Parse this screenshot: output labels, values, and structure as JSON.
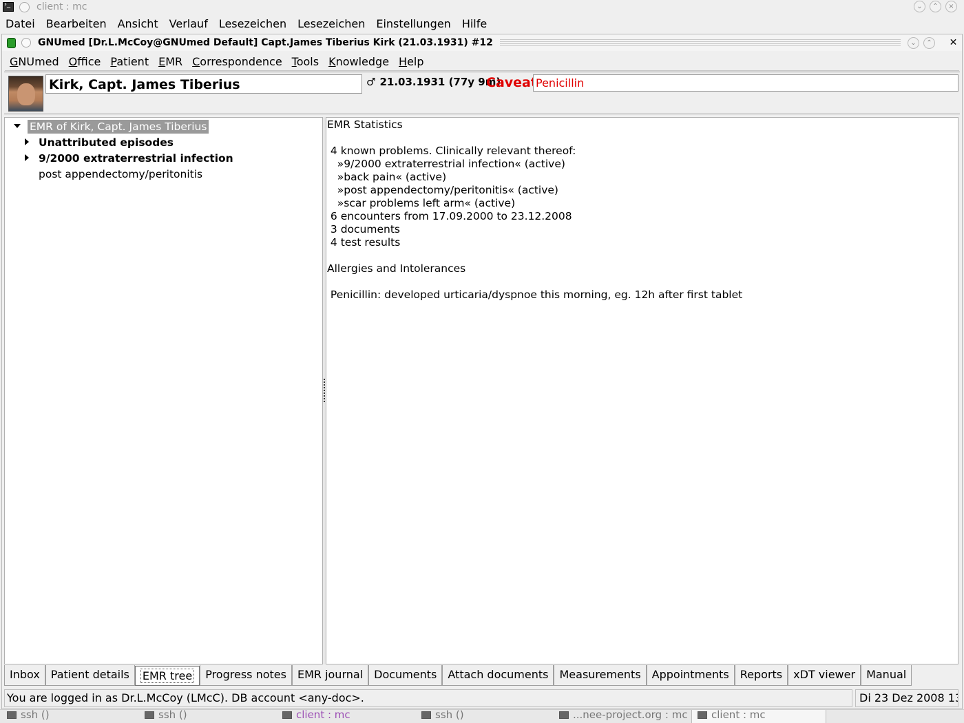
{
  "outer_window": {
    "title": "client : mc",
    "menu": [
      "Datei",
      "Bearbeiten",
      "Ansicht",
      "Verlauf",
      "Lesezeichen",
      "Lesezeichen",
      "Einstellungen",
      "Hilfe"
    ]
  },
  "gnumed_window": {
    "title": "GNUmed [Dr.L.McCoy@GNUmed Default] Capt.James Tiberius Kirk (21.03.1931) #12",
    "close_glyph": "✕",
    "menu": [
      "GNUmed",
      "Office",
      "Patient",
      "EMR",
      "Correspondence",
      "Tools",
      "Knowledge",
      "Help"
    ]
  },
  "patient": {
    "name": "Kirk, Capt. James Tiberius",
    "gender_symbol": "♂",
    "dob": "21.03.1931 (77y 9m)",
    "caveat_label": "Caveat",
    "caveat_value": "Penicillin"
  },
  "emr_tree": {
    "root": "EMR of Kirk, Capt. James Tiberius",
    "nodes": [
      {
        "label": "Unattributed episodes"
      },
      {
        "label": "9/2000 extraterrestrial infection"
      },
      {
        "label": "post appendectomy/peritonitis"
      }
    ]
  },
  "stats": {
    "lines": [
      "EMR Statistics",
      "",
      " 4 known problems. Clinically relevant thereof:",
      "   »9/2000 extraterrestrial infection« (active)",
      "   »back pain« (active)",
      "   »post appendectomy/peritonitis« (active)",
      "   »scar problems left arm« (active)",
      " 6 encounters from 17.09.2000 to 23.12.2008",
      " 3 documents",
      " 4 test results",
      "",
      "Allergies and Intolerances",
      "",
      " Penicillin: developed urticaria/dyspnoe this morning, eg. 12h after first tablet"
    ]
  },
  "tabs": {
    "items": [
      "Inbox",
      "Patient details",
      "EMR tree",
      "Progress notes",
      "EMR journal",
      "Documents",
      "Attach documents",
      "Measurements",
      "Appointments",
      "Reports",
      "xDT viewer",
      "Manual"
    ],
    "active": "EMR tree"
  },
  "status": {
    "left": "You are logged in as Dr.L.McCoy (LMcC). DB account <any-doc>.",
    "right": "Di 23 Dez 2008 13:0"
  },
  "taskbar": {
    "items": [
      "ssh ()",
      "ssh ()",
      "client : mc",
      "ssh ()",
      "...nee-project.org : mc",
      "client : mc"
    ]
  }
}
